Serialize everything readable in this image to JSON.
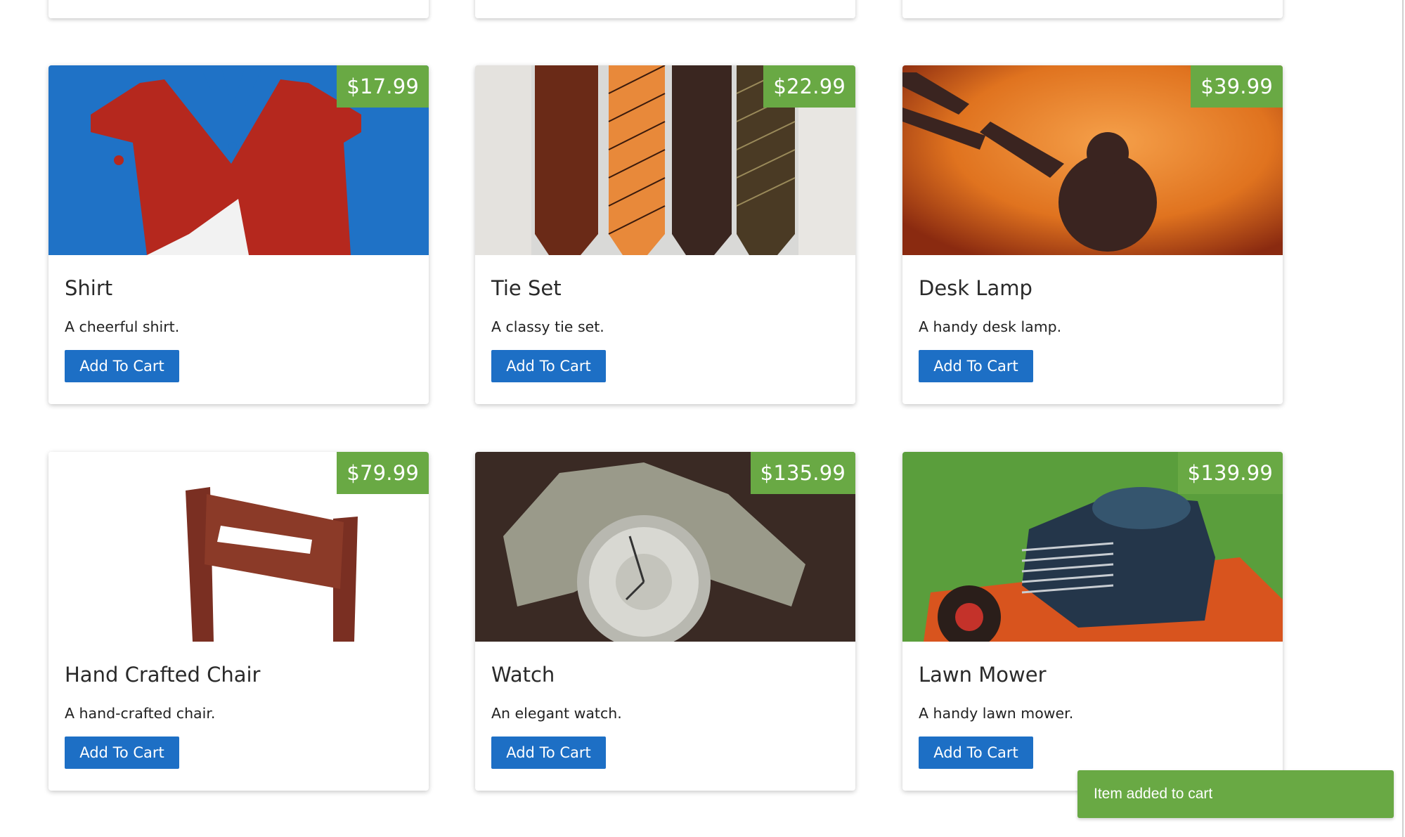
{
  "products": [
    {
      "name": "Shirt",
      "description": "A cheerful shirt.",
      "price": "$17.99",
      "button": "Add To Cart",
      "image": "shirt-image"
    },
    {
      "name": "Tie Set",
      "description": "A classy tie set.",
      "price": "$22.99",
      "button": "Add To Cart",
      "image": "tie-set-image"
    },
    {
      "name": "Desk Lamp",
      "description": "A handy desk lamp.",
      "price": "$39.99",
      "button": "Add To Cart",
      "image": "desk-lamp-image"
    },
    {
      "name": "Hand Crafted Chair",
      "description": "A hand-crafted chair.",
      "price": "$79.99",
      "button": "Add To Cart",
      "image": "chair-image"
    },
    {
      "name": "Watch",
      "description": "An elegant watch.",
      "price": "$135.99",
      "button": "Add To Cart",
      "image": "watch-image"
    },
    {
      "name": "Lawn Mower",
      "description": "A handy lawn mower.",
      "price": "$139.99",
      "button": "Add To Cart",
      "image": "lawn-mower-image"
    }
  ],
  "toast": {
    "message": "Item added to cart"
  },
  "colors": {
    "price_badge": "#69a944",
    "button": "#1d6fc5",
    "toast": "#69a944"
  }
}
